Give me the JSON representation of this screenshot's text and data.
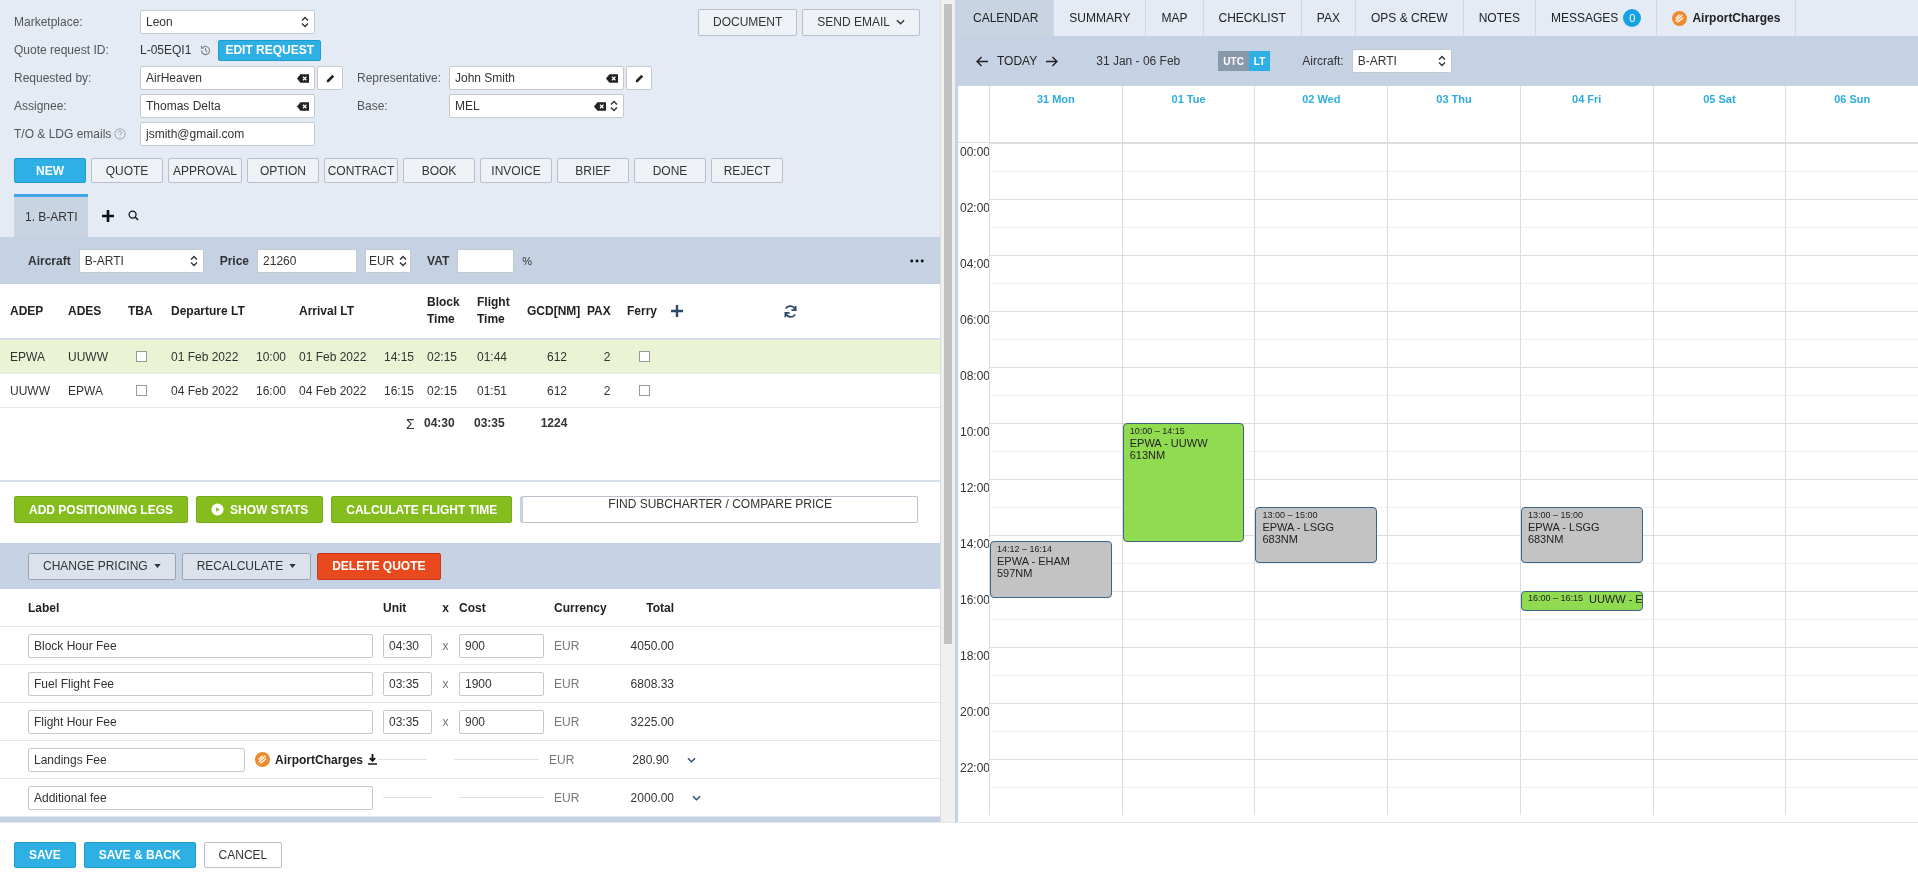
{
  "quote_form": {
    "marketplace": {
      "label": "Marketplace:",
      "value": "Leon"
    },
    "quote_request": {
      "label": "Quote request ID:",
      "value": "L-05EQI1",
      "button": "EDIT REQUEST"
    },
    "requested_by": {
      "label": "Requested by:",
      "value": "AirHeaven"
    },
    "representative": {
      "label": "Representative:",
      "value": "John Smith"
    },
    "assignee": {
      "label": "Assignee:",
      "value": "Thomas Delta"
    },
    "base": {
      "label": "Base:",
      "value": "MEL"
    },
    "emails": {
      "label": "T/O & LDG emails",
      "value": "jsmith@gmail.com"
    },
    "document_button": "DOCUMENT",
    "email_button": "SEND EMAIL"
  },
  "status_steps": [
    {
      "label": "NEW",
      "selected": true
    },
    {
      "label": "QUOTE",
      "selected": false
    },
    {
      "label": "APPROVAL",
      "selected": false
    },
    {
      "label": "OPTION",
      "selected": false
    },
    {
      "label": "CONTRACT",
      "selected": false
    },
    {
      "label": "BOOK",
      "selected": false
    },
    {
      "label": "INVOICE",
      "selected": false
    },
    {
      "label": "BRIEF",
      "selected": false
    },
    {
      "label": "DONE",
      "selected": false
    },
    {
      "label": "REJECT",
      "selected": false
    }
  ],
  "aircraft_tabs": [
    {
      "label": "1. B-ARTI",
      "selected": true
    }
  ],
  "aircraft_bar": {
    "aircraft_label": "Aircraft",
    "aircraft": "B-ARTI",
    "price_label": "Price",
    "price": "21260",
    "currency": "EUR",
    "vat_label": "VAT",
    "vat_unit": "%"
  },
  "legs": {
    "columns": [
      "ADEP",
      "ADES",
      "TBA",
      "Departure LT",
      "Arrival LT",
      "Block Time",
      "Flight Time",
      "GCD[NM]",
      "PAX",
      "Ferry"
    ],
    "rows": [
      {
        "adep": "EPWA",
        "ades": "UUWW",
        "tba": false,
        "dep_date": "01 Feb 2022",
        "dep_time": "10:00",
        "arr_date": "01 Feb 2022",
        "arr_time": "14:15",
        "block": "02:15",
        "flight": "01:44",
        "gcd": "612",
        "pax": "2",
        "ferry": false,
        "selected": true
      },
      {
        "adep": "UUWW",
        "ades": "EPWA",
        "tba": false,
        "dep_date": "04 Feb 2022",
        "dep_time": "16:00",
        "arr_date": "04 Feb 2022",
        "arr_time": "16:15",
        "block": "02:15",
        "flight": "01:51",
        "gcd": "612",
        "pax": "2",
        "ferry": false,
        "selected": false
      }
    ],
    "totals": {
      "sigma": "Σ",
      "block": "04:30",
      "flight": "03:35",
      "gcd": "1224"
    }
  },
  "leg_actions": [
    {
      "label": "ADD POSITIONING LEGS",
      "kind": "plain"
    },
    {
      "label": "SHOW STATS",
      "kind": "stats"
    },
    {
      "label": "CALCULATE FLIGHT TIME",
      "kind": "plain"
    }
  ],
  "compare_button": "FIND SUBCHARTER / COMPARE PRICE",
  "pricing": {
    "actions": [
      {
        "label": "CHANGE PRICING",
        "kind": "dropdown"
      },
      {
        "label": "RECALCULATE",
        "kind": "dropdown"
      },
      {
        "label": "DELETE QUOTE",
        "kind": "danger"
      }
    ],
    "columns": [
      "Label",
      "Unit",
      "x",
      "Cost",
      "Currency",
      "Total"
    ],
    "rows": [
      {
        "kind": "rate",
        "label": "Block Hour Fee",
        "unit": "04:30",
        "times": "x",
        "cost": "900",
        "currency": "EUR",
        "total": "4050.00"
      },
      {
        "kind": "rate",
        "label": "Fuel Flight Fee",
        "unit": "03:35",
        "times": "x",
        "cost": "1900",
        "currency": "EUR",
        "total": "6808.33"
      },
      {
        "kind": "rate",
        "label": "Flight Hour Fee",
        "unit": "03:35",
        "times": "x",
        "cost": "900",
        "currency": "EUR",
        "total": "3225.00"
      },
      {
        "kind": "airport",
        "label": "Landings Fee",
        "source": "AirportCharges",
        "currency": "EUR",
        "total": "280.90"
      },
      {
        "kind": "fixed",
        "label": "Additional fee",
        "currency": "EUR",
        "total": "2000.00"
      }
    ]
  },
  "footer_buttons": [
    {
      "label": "SAVE",
      "kind": "primary"
    },
    {
      "label": "SAVE & BACK",
      "kind": "primary"
    },
    {
      "label": "CANCEL",
      "kind": "plain"
    }
  ],
  "right_tabs": [
    {
      "label": "CALENDAR",
      "selected": true
    },
    {
      "label": "SUMMARY",
      "selected": false
    },
    {
      "label": "MAP",
      "selected": false
    },
    {
      "label": "CHECKLIST",
      "selected": false
    },
    {
      "label": "PAX",
      "selected": false
    },
    {
      "label": "OPS & CREW",
      "selected": false
    },
    {
      "label": "NOTES",
      "selected": false
    },
    {
      "label": "MESSAGES",
      "selected": false,
      "badge": "0"
    },
    {
      "label": "AirportCharges",
      "selected": false,
      "logo": true
    }
  ],
  "calendar_toolbar": {
    "today": "TODAY",
    "range": "31 Jan - 06 Feb",
    "time_modes": [
      {
        "label": "UTC",
        "selected": false
      },
      {
        "label": "LT",
        "selected": true
      }
    ],
    "aircraft_label": "Aircraft:",
    "aircraft": "B-ARTI"
  },
  "hour_labels": [
    "00:00",
    "02:00",
    "04:00",
    "06:00",
    "08:00",
    "10:00",
    "12:00",
    "14:00",
    "16:00",
    "18:00",
    "20:00",
    "22:00"
  ],
  "days": [
    {
      "label": "31 Mon",
      "events": [
        {
          "time": "14:12 – 16:14",
          "route": "EPWA - EHAM",
          "distance": "597NM",
          "confirmed": false
        }
      ]
    },
    {
      "label": "01 Tue",
      "events": [
        {
          "time": "10:00 – 14:15",
          "route": "EPWA - UUWW",
          "distance": "613NM",
          "confirmed": true
        }
      ]
    },
    {
      "label": "02 Wed",
      "events": [
        {
          "time": "13:00 – 15:00",
          "route": "EPWA - LSGG",
          "distance": "683NM",
          "confirmed": false
        }
      ]
    },
    {
      "label": "03 Thu"
    },
    {
      "label": "04 Fri",
      "events": [
        {
          "time": "13:00 – 15:00",
          "route": "EPWA - LSGG",
          "distance": "683NM",
          "confirmed": false
        },
        {
          "time": "16:00 – 16:15",
          "route": "UUWW - E",
          "confirmed": true
        }
      ]
    },
    {
      "label": "05 Sat"
    },
    {
      "label": "06 Sun"
    }
  ]
}
